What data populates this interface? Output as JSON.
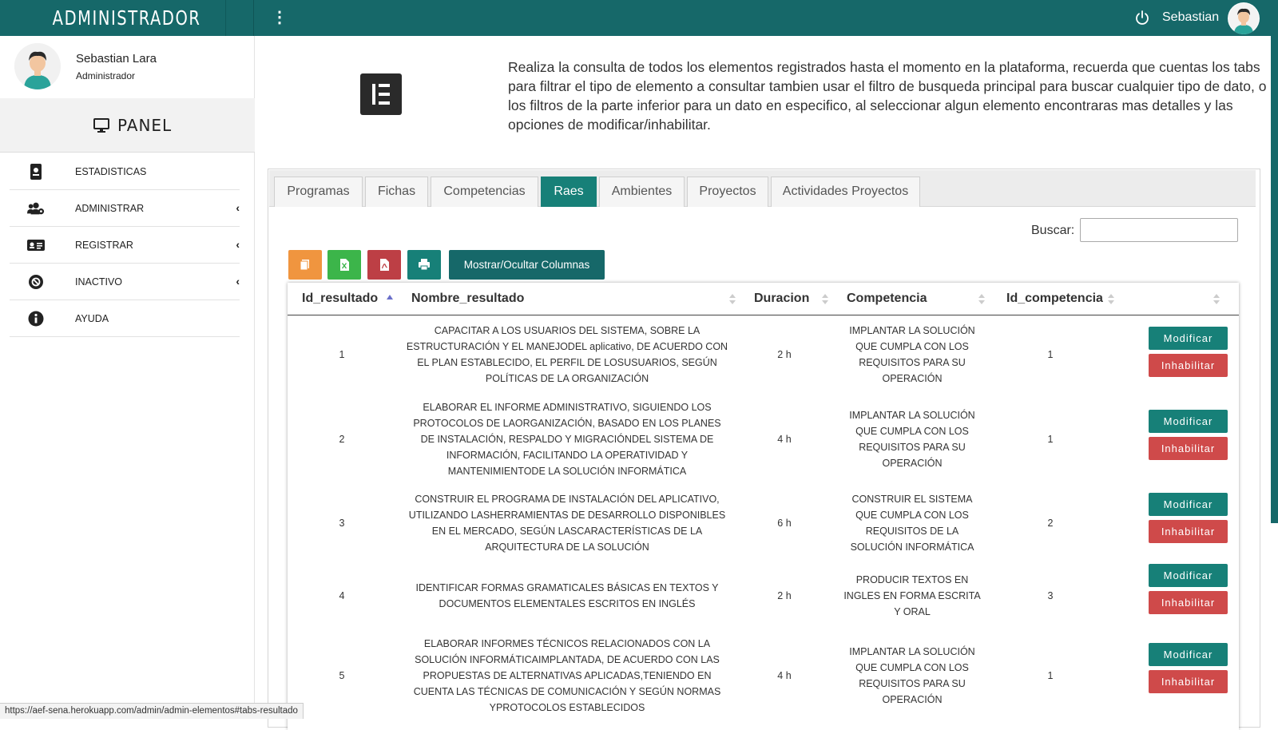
{
  "app": {
    "brand": "ADMINISTRADOR",
    "top_user_name": "Sebastian",
    "accent_color": "#166869"
  },
  "sidebar": {
    "profile_name": "Sebastian Lara",
    "profile_role": "Administrador",
    "panel_label": "PANEL",
    "items": [
      {
        "label": "ESTADISTICAS",
        "icon": "id-badge-icon",
        "submenu": false
      },
      {
        "label": "ADMINISTRAR",
        "icon": "users-cog-icon",
        "submenu": true
      },
      {
        "label": "REGISTRAR",
        "icon": "id-card-icon",
        "submenu": true
      },
      {
        "label": "INACTIVO",
        "icon": "ban-icon",
        "submenu": true
      },
      {
        "label": "AYUDA",
        "icon": "info-icon",
        "submenu": false
      }
    ]
  },
  "main": {
    "intro": "Realiza la consulta de todos los elementos registrados hasta el momento en la plataforma, recuerda que cuentas los tabs para filtrar el tipo de elemento a consultar tambien usar el filtro de busqueda principal para buscar cualquier tipo de dato, o los filtros de la parte inferior para un dato en especifico, al seleccionar algun elemento encontraras mas detalles y las opciones de modificar/inhabilitar.",
    "tabs": [
      "Programas",
      "Fichas",
      "Competencias",
      "Raes",
      "Ambientes",
      "Proyectos",
      "Actividades Proyectos"
    ],
    "active_tab": "Raes",
    "search_label": "Buscar:",
    "search_value": "",
    "toolbar": {
      "buttons": [
        {
          "icon": "copy-icon",
          "color": "#f0953f"
        },
        {
          "icon": "excel-icon",
          "color": "#3cb54a"
        },
        {
          "icon": "pdf-icon",
          "color": "#bd3f45"
        },
        {
          "icon": "print-icon",
          "color": "#178078"
        }
      ],
      "columns_label": "Mostrar/Ocultar Columnas"
    },
    "table": {
      "headers": [
        "Id_resultado",
        "Nombre_resultado",
        "Duracion",
        "Competencia",
        "Id_competencia",
        ""
      ],
      "modify_label": "Modificar",
      "disable_label": "Inhabilitar",
      "rows": [
        {
          "id": "1",
          "nombre": [
            "CAPACITAR A LOS USUARIOS DEL SISTEMA, SOBRE LA",
            "ESTRUCTURACIÓN Y EL MANEJODEL aplicativo, DE ACUERDO CON",
            "EL PLAN ESTABLECIDO, EL PERFIL DE LOSUSUARIOS, SEGÚN",
            "POLÍTICAS DE LA ORGANIZACIÓN"
          ],
          "duracion": "2 h",
          "competencia": [
            "IMPLANTAR LA SOLUCIÓN",
            "QUE CUMPLA CON LOS",
            "REQUISITOS PARA SU",
            "OPERACIÓN"
          ],
          "id_competencia": "1"
        },
        {
          "id": "2",
          "nombre": [
            "ELABORAR EL INFORME ADMINISTRATIVO, SIGUIENDO LOS",
            "PROTOCOLOS DE LAORGANIZACIÓN, BASADO EN LOS PLANES",
            "DE INSTALACIÓN, RESPALDO Y MIGRACIÓNDEL SISTEMA DE",
            "INFORMACIÓN, FACILITANDO LA OPERATIVIDAD Y",
            "MANTENIMIENTODE LA SOLUCIÓN INFORMÁTICA"
          ],
          "duracion": "4 h",
          "competencia": [
            "IMPLANTAR LA SOLUCIÓN",
            "QUE CUMPLA CON LOS",
            "REQUISITOS PARA SU",
            "OPERACIÓN"
          ],
          "id_competencia": "1"
        },
        {
          "id": "3",
          "nombre": [
            "CONSTRUIR EL PROGRAMA DE INSTALACIÓN DEL APLICATIVO,",
            "UTILIZANDO LASHERRAMIENTAS DE DESARROLLO DISPONIBLES",
            "EN EL MERCADO, SEGÚN LASCARACTERÍSTICAS DE LA",
            "ARQUITECTURA DE LA SOLUCIÓN"
          ],
          "duracion": "6 h",
          "competencia": [
            "CONSTRUIR EL SISTEMA",
            "QUE CUMPLA CON LOS",
            "REQUISITOS DE LA",
            "SOLUCIÓN INFORMÁTICA"
          ],
          "id_competencia": "2"
        },
        {
          "id": "4",
          "nombre": [
            "IDENTIFICAR FORMAS GRAMATICALES BÁSICAS EN TEXTOS Y",
            "DOCUMENTOS ELEMENTALES ESCRITOS EN INGLÉS"
          ],
          "duracion": "2 h",
          "competencia": [
            "PRODUCIR TEXTOS EN",
            "INGLES EN FORMA ESCRITA",
            "Y ORAL"
          ],
          "id_competencia": "3"
        },
        {
          "id": "5",
          "nombre": [
            "ELABORAR INFORMES TÉCNICOS RELACIONADOS CON LA",
            "SOLUCIÓN INFORMÁTICAIMPLANTADA, DE ACUERDO CON LAS",
            "PROPUESTAS DE ALTERNATIVAS APLICADAS,TENIENDO EN",
            "CUENTA LAS TÉCNICAS DE COMUNICACIÓN Y SEGÚN NORMAS",
            "YPROTOCOLOS ESTABLECIDOS"
          ],
          "duracion": "4 h",
          "competencia": [
            "IMPLANTAR LA SOLUCIÓN",
            "QUE CUMPLA CON LOS",
            "REQUISITOS PARA SU",
            "OPERACIÓN"
          ],
          "id_competencia": "1"
        }
      ]
    }
  },
  "statusbar": {
    "url": "https://aef-sena.herokuapp.com/admin/admin-elementos#tabs-resultado"
  }
}
